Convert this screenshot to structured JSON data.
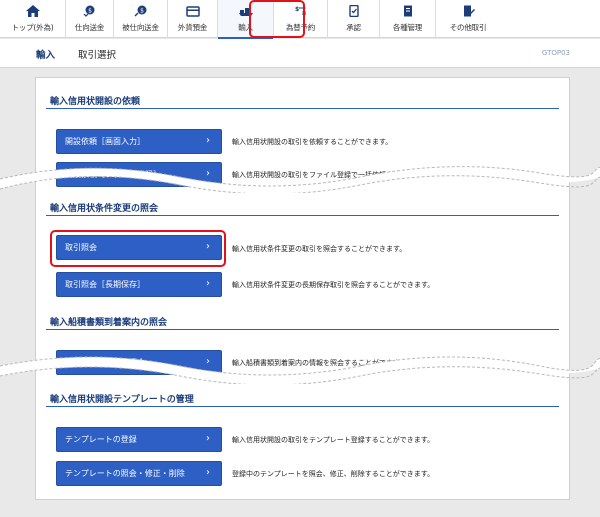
{
  "nav": [
    {
      "label": "トップ(外為)",
      "icon": "home-icon"
    },
    {
      "label": "仕向送金",
      "icon": "outgoing-remittance-icon"
    },
    {
      "label": "被仕向送金",
      "icon": "incoming-remittance-icon"
    },
    {
      "label": "外貨預金",
      "icon": "deposit-icon"
    },
    {
      "label": "輸入",
      "icon": "import-icon",
      "active": true
    },
    {
      "label": "為替予約",
      "icon": "exchange-contract-icon"
    },
    {
      "label": "承認",
      "icon": "approval-icon"
    },
    {
      "label": "各種管理",
      "icon": "management-icon"
    },
    {
      "label": "その他取引",
      "icon": "other-transactions-icon"
    }
  ],
  "breadcrumb": {
    "category": "輸入",
    "page": "取引選択",
    "code": "GTOP03"
  },
  "sections": {
    "lc_request": {
      "title": "輸入信用状開設の依頼",
      "btn1": "開設依頼［画面入力］",
      "desc1": "輸入信用状開設の取引を依頼することができます。",
      "btn2_partial": "開設依頼［ファイル登録］",
      "desc2_partial": "輸入信用状開設の取引をファイル登録で一括依頼することができます。"
    },
    "lc_amend": {
      "title": "輸入信用状条件変更の照会",
      "btn1": "取引照会",
      "desc1": "輸入信用状条件変更の取引を照会することができます。",
      "btn2": "取引照会［長期保存］",
      "desc2": "輸入信用状条件変更の長期保存取引を照会することができます。"
    },
    "shipping": {
      "title": "輸入船積書類到着案内の照会",
      "btn1_partial": "船積書類到着案内照会",
      "desc1_partial": "輸入船積書類到着案内の情報を照会することができます。"
    },
    "template": {
      "title": "輸入信用状開設テンプレートの管理",
      "btn1": "テンプレートの登録",
      "desc1": "輸入信用状開設の取引をテンプレート登録することができます。",
      "btn2": "テンプレートの照会・修正・削除",
      "desc2": "登録中のテンプレートを照会、修正、削除することができます。"
    }
  },
  "colors": {
    "accent": "#2d5fc5",
    "highlight": "#e3121a",
    "heading": "#1c3d7a"
  }
}
